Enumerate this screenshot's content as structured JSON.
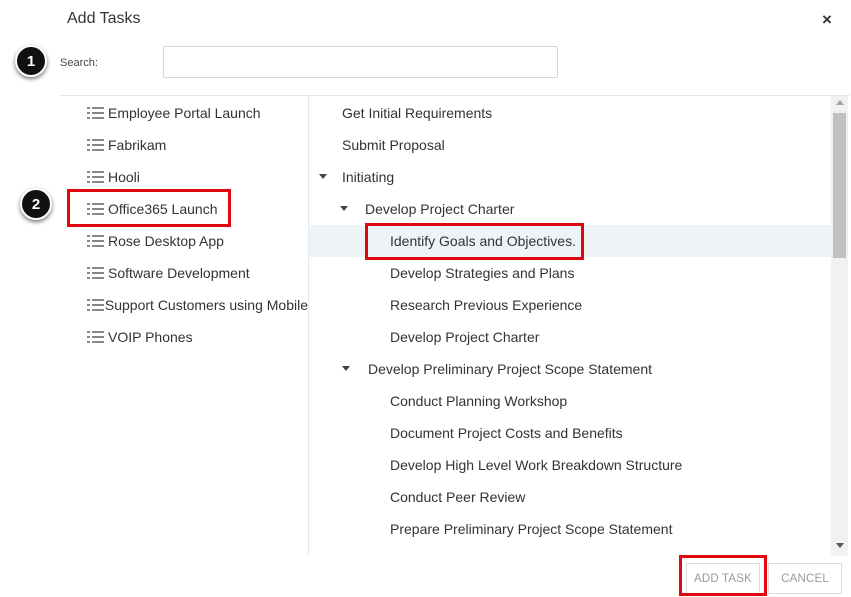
{
  "dialog": {
    "title": "Add Tasks",
    "close_icon": "×"
  },
  "callouts": {
    "badge_1": "1",
    "badge_2": "2"
  },
  "search": {
    "label": "Search:",
    "value": "",
    "placeholder": ""
  },
  "projects": [
    {
      "label": "Employee Portal Launch"
    },
    {
      "label": "Fabrikam"
    },
    {
      "label": "Hooli"
    },
    {
      "label": "Office365 Launch",
      "highlighted": true
    },
    {
      "label": "Rose Desktop App"
    },
    {
      "label": "Software Development"
    },
    {
      "label": "Support Customers using Mobile"
    },
    {
      "label": "VOIP Phones"
    }
  ],
  "tasks": [
    {
      "label": "Get Initial Requirements",
      "level": 0,
      "expandable": false
    },
    {
      "label": "Submit Proposal",
      "level": 0,
      "expandable": false
    },
    {
      "label": "Initiating",
      "level": 0,
      "expandable": true,
      "expanded": true
    },
    {
      "label": "Develop Project Charter",
      "level": 1,
      "expandable": true,
      "expanded": true
    },
    {
      "label": "Identify Goals and Objectives.",
      "level": 2,
      "expandable": false,
      "selected": true
    },
    {
      "label": "Develop Strategies and Plans",
      "level": 2,
      "expandable": false
    },
    {
      "label": "Research Previous Experience",
      "level": 2,
      "expandable": false
    },
    {
      "label": "Develop Project Charter",
      "level": 2,
      "expandable": false
    },
    {
      "label": "Develop Preliminary Project Scope Statement",
      "level": 1,
      "expandable": true,
      "expanded": true
    },
    {
      "label": "Conduct Planning Workshop",
      "level": 2,
      "expandable": false
    },
    {
      "label": "Document Project Costs and Benefits",
      "level": 2,
      "expandable": false
    },
    {
      "label": "Develop High Level Work Breakdown Structure",
      "level": 2,
      "expandable": false
    },
    {
      "label": "Conduct Peer Review",
      "level": 2,
      "expandable": false
    },
    {
      "label": "Prepare Preliminary Project Scope Statement",
      "level": 2,
      "expandable": false
    }
  ],
  "buttons": {
    "add_task": "ADD TASK",
    "cancel": "CANCEL"
  },
  "colors": {
    "callout_red": "#e0070f",
    "selected_row": "#eef3f7"
  }
}
